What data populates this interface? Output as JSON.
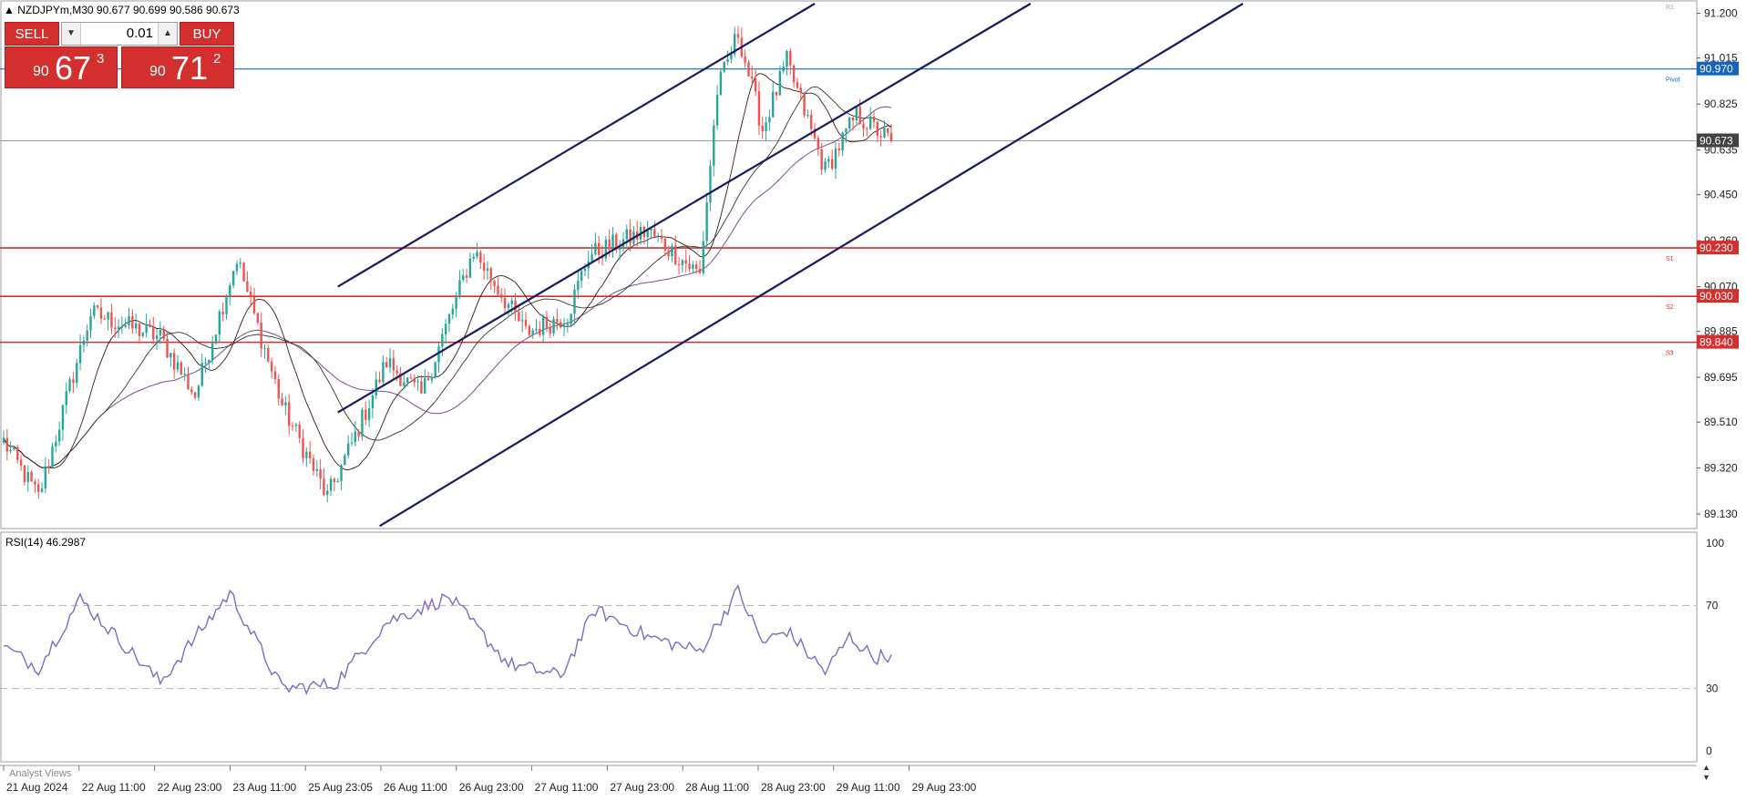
{
  "header": {
    "symbol_line": "NZDJPYm,M30  90.677 90.699 90.586 90.673",
    "title_marker": "▲"
  },
  "trade_panel": {
    "sell_label": "SELL",
    "buy_label": "BUY",
    "lot_value": "0.01",
    "sell_price": {
      "prefix": "90",
      "main": "67",
      "sup": "3"
    },
    "buy_price": {
      "prefix": "90",
      "main": "71",
      "sup": "2"
    }
  },
  "price_axis": {
    "ticks": [
      "91.200",
      "91.015",
      "90.825",
      "90.635",
      "90.450",
      "90.260",
      "90.070",
      "89.885",
      "89.695",
      "89.510",
      "89.320",
      "89.130"
    ],
    "tick_values": [
      91.2,
      91.015,
      90.825,
      90.635,
      90.45,
      90.26,
      90.07,
      89.885,
      89.695,
      89.51,
      89.32,
      89.13
    ],
    "labels": [
      {
        "text": "90.970",
        "value": 90.97,
        "color": "#1565c0"
      },
      {
        "text": "90.673",
        "value": 90.673,
        "color": "#424242"
      },
      {
        "text": "90.230",
        "value": 90.23,
        "color": "#d32f2f"
      },
      {
        "text": "90.030",
        "value": 90.03,
        "color": "#d32f2f"
      },
      {
        "text": "89.840",
        "value": 89.84,
        "color": "#d32f2f"
      }
    ]
  },
  "levels": [
    {
      "name": "Pivot",
      "value": 90.97,
      "color": "#1565c0"
    },
    {
      "name": "S1",
      "value": 90.23,
      "color": "#d32f2f"
    },
    {
      "name": "S2",
      "value": 90.03,
      "color": "#d32f2f"
    },
    {
      "name": "S3",
      "value": 89.84,
      "color": "#d32f2f"
    }
  ],
  "top_marker": "R1",
  "current_price": 90.673,
  "time_axis": [
    "21 Aug 2024",
    "22 Aug 11:00",
    "22 Aug 23:00",
    "23 Aug 11:00",
    "25 Aug 23:05",
    "26 Aug 11:00",
    "26 Aug 23:00",
    "27 Aug 11:00",
    "27 Aug 23:00",
    "28 Aug 11:00",
    "28 Aug 23:00",
    "29 Aug 11:00",
    "29 Aug 23:00"
  ],
  "rsi": {
    "title": "RSI(14) 46.2987",
    "ticks": [
      "100",
      "70",
      "30",
      "0"
    ],
    "tick_values": [
      100,
      70,
      30,
      0
    ],
    "levels": [
      70,
      30
    ]
  },
  "bottom_tab": "Analyst Views",
  "colors": {
    "bull": "#26a69a",
    "bear": "#ef5350",
    "channel": "#1a1a5e",
    "ma_fast": "#3a1a1a",
    "ma_mid": "#2e3b2e",
    "ma_slow": "#7b4f8a",
    "rsi_line": "#7e6bbf"
  },
  "chart_data": {
    "type": "candlestick",
    "symbol": "NZDJPYm",
    "timeframe": "M30",
    "ylim": [
      89.07,
      91.24
    ],
    "rsi_ylim": [
      0,
      100
    ],
    "key_points": [
      {
        "bar": 0,
        "price": 89.43
      },
      {
        "bar": 10,
        "price": 89.2
      },
      {
        "bar": 25,
        "price": 89.96
      },
      {
        "bar": 45,
        "price": 89.86
      },
      {
        "bar": 55,
        "price": 89.62
      },
      {
        "bar": 67,
        "price": 90.19
      },
      {
        "bar": 72,
        "price": 89.95
      },
      {
        "bar": 80,
        "price": 89.58
      },
      {
        "bar": 93,
        "price": 89.2
      },
      {
        "bar": 100,
        "price": 89.42
      },
      {
        "bar": 110,
        "price": 89.76
      },
      {
        "bar": 120,
        "price": 89.62
      },
      {
        "bar": 135,
        "price": 90.22
      },
      {
        "bar": 150,
        "price": 89.88
      },
      {
        "bar": 162,
        "price": 89.95
      },
      {
        "bar": 168,
        "price": 90.2
      },
      {
        "bar": 185,
        "price": 90.3
      },
      {
        "bar": 200,
        "price": 90.12
      },
      {
        "bar": 205,
        "price": 90.88
      },
      {
        "bar": 211,
        "price": 91.12
      },
      {
        "bar": 218,
        "price": 90.72
      },
      {
        "bar": 225,
        "price": 91.0
      },
      {
        "bar": 236,
        "price": 90.55
      },
      {
        "bar": 245,
        "price": 90.78
      },
      {
        "bar": 255,
        "price": 90.67
      }
    ],
    "channels": [
      {
        "x1_bar": 96,
        "y1": 90.07,
        "x2_bar": 233,
        "y2": 91.24
      },
      {
        "x1_bar": 96,
        "y1": 89.55,
        "x2_bar": 295,
        "y2": 91.24
      },
      {
        "x1_bar": 108,
        "y1": 89.08,
        "x2_bar": 356,
        "y2": 91.24
      }
    ],
    "rsi_key_points": [
      {
        "bar": 0,
        "rsi": 50
      },
      {
        "bar": 10,
        "rsi": 40
      },
      {
        "bar": 22,
        "rsi": 73
      },
      {
        "bar": 45,
        "rsi": 33
      },
      {
        "bar": 65,
        "rsi": 76
      },
      {
        "bar": 80,
        "rsi": 30
      },
      {
        "bar": 95,
        "rsi": 32
      },
      {
        "bar": 110,
        "rsi": 62
      },
      {
        "bar": 128,
        "rsi": 74
      },
      {
        "bar": 145,
        "rsi": 42
      },
      {
        "bar": 160,
        "rsi": 36
      },
      {
        "bar": 170,
        "rsi": 68
      },
      {
        "bar": 185,
        "rsi": 55
      },
      {
        "bar": 200,
        "rsi": 48
      },
      {
        "bar": 211,
        "rsi": 77
      },
      {
        "bar": 218,
        "rsi": 52
      },
      {
        "bar": 225,
        "rsi": 58
      },
      {
        "bar": 236,
        "rsi": 38
      },
      {
        "bar": 243,
        "rsi": 55
      },
      {
        "bar": 250,
        "rsi": 45
      },
      {
        "bar": 255,
        "rsi": 46.3
      }
    ]
  }
}
